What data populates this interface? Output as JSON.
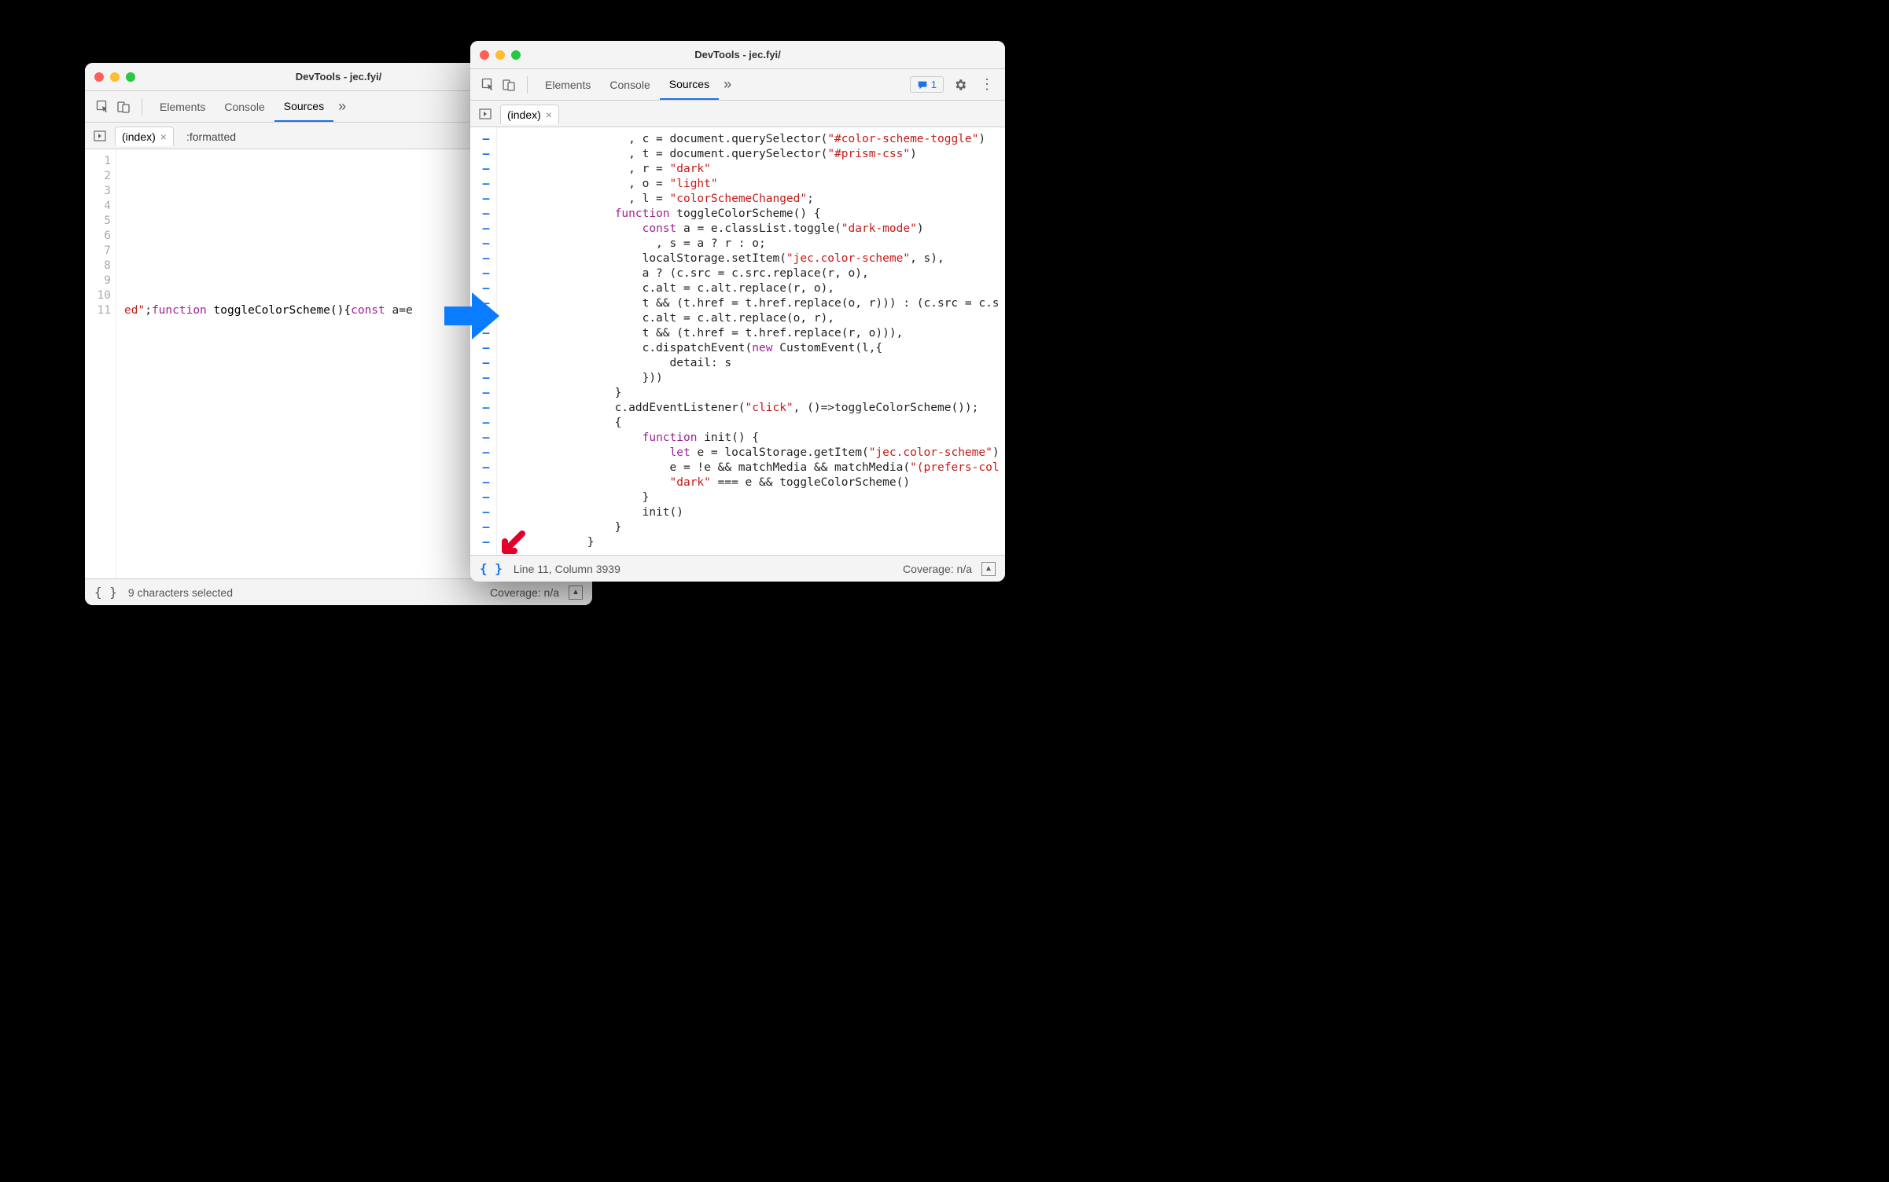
{
  "leftWindow": {
    "title": "DevTools - jec.fyi/",
    "tabs": {
      "elements": "Elements",
      "console": "Console",
      "sources": "Sources"
    },
    "fileTabs": {
      "index": "(index)",
      "formatted": ":formatted"
    },
    "lineNumbers": [
      "1",
      "2",
      "3",
      "4",
      "5",
      "6",
      "7",
      "8",
      "9",
      "10",
      "11"
    ],
    "codeLine11_part1": "ed\"",
    "codeLine11_kw1": "function",
    "codeLine11_fn": " toggleColorScheme(){",
    "codeLine11_kw2": "const",
    "codeLine11_tail": " a=e",
    "status_selected": "9 characters selected",
    "status_coverage": "Coverage: n/a"
  },
  "rightWindow": {
    "title": "DevTools - jec.fyi/",
    "tabs": {
      "elements": "Elements",
      "console": "Console",
      "sources": "Sources"
    },
    "msgCount": "1",
    "fileTabs": {
      "index": "(index)"
    },
    "status_line": "Line 11, Column 3939",
    "status_coverage": "Coverage: n/a"
  }
}
